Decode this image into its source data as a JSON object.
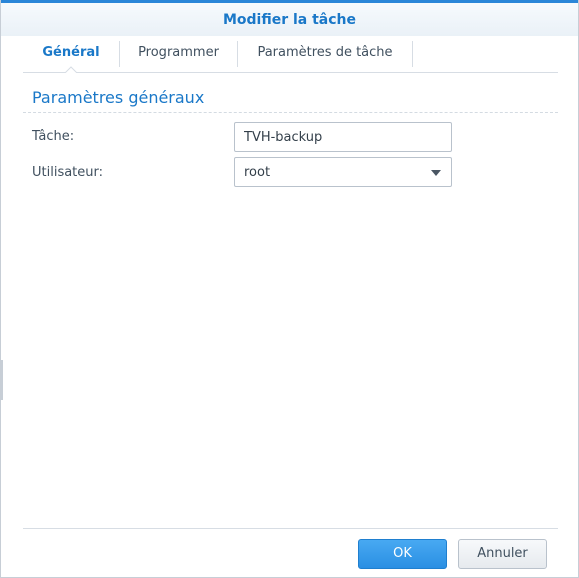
{
  "dialog": {
    "title": "Modifier la tâche"
  },
  "tabs": [
    {
      "label": "Général",
      "active": true
    },
    {
      "label": "Programmer",
      "active": false
    },
    {
      "label": "Paramètres de tâche",
      "active": false
    }
  ],
  "section": {
    "title": "Paramètres généraux"
  },
  "form": {
    "task_label": "Tâche:",
    "task_value": "TVH-backup",
    "user_label": "Utilisateur:",
    "user_value": "root"
  },
  "footer": {
    "ok_label": "OK",
    "cancel_label": "Annuler"
  },
  "colors": {
    "accent": "#1a78c8",
    "primary_button": "#2a8fe3"
  },
  "icons": {
    "dropdown": "chevron-down-icon"
  }
}
